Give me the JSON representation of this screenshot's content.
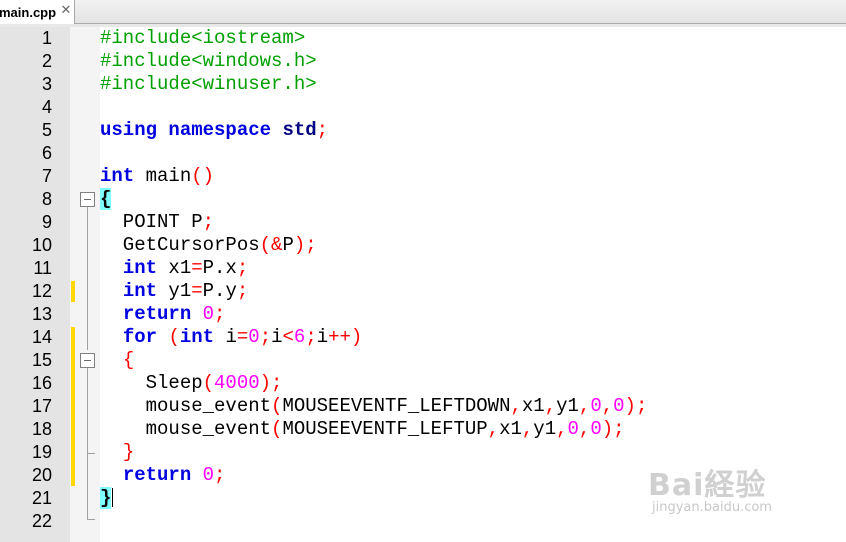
{
  "tab": {
    "filename": "main.cpp",
    "close_glyph": "✕"
  },
  "line_numbers": [
    "1",
    "2",
    "3",
    "4",
    "5",
    "6",
    "7",
    "8",
    "9",
    "10",
    "11",
    "12",
    "13",
    "14",
    "15",
    "16",
    "17",
    "18",
    "19",
    "20",
    "21",
    "22"
  ],
  "code": {
    "l1": "#include<iostream>",
    "l2": "#include<windows.h>",
    "l3": "#include<winuser.h>",
    "l5_using": "using",
    "l5_namespace": "namespace",
    "l5_std": "std",
    "l5_semi": ";",
    "l7_int": "int",
    "l7_main": " main",
    "l7_parens": "()",
    "l8_brace": "{",
    "l9": "  POINT P",
    "l10_fn": "  GetCursorPos",
    "l11_decl": " x1",
    "l11_rhs": "P.x",
    "l12_decl": " y1",
    "l12_rhs": "P.y",
    "l13_return": "return",
    "l13_val": "0",
    "l14_for": "for",
    "l14_int": "int",
    "l16_fn": "    Sleep",
    "l16_arg": "4000",
    "l17_fn": "    mouse_event",
    "l17_arg": "MOUSEEVENTF_LEFTDOWN",
    "l18_fn": "    mouse_event",
    "l18_arg": "MOUSEEVENTF_LEFTUP",
    "l20_return": "return",
    "l20_val": "0",
    "l21_brace": "}"
  },
  "watermark": {
    "main": "Bai経验",
    "sub": "jingyan.baidu.com"
  },
  "icons": {
    "close": "close-icon",
    "fold": "fold-collapse-icon"
  },
  "colors": {
    "keyword": "#0000e0",
    "preprocessor": "#00a000",
    "number": "#ff00ff",
    "operator": "#ff0000",
    "brace_highlight": "#80ffff",
    "change_marker": "#ffd800"
  }
}
